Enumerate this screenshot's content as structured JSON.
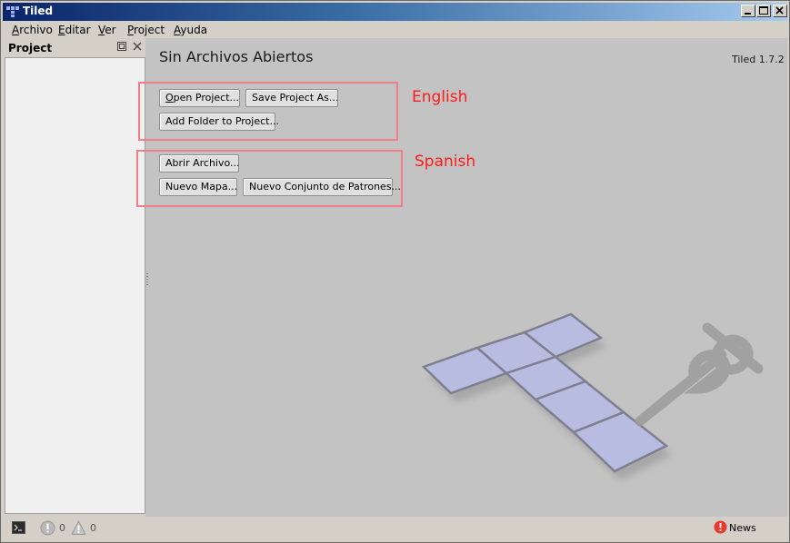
{
  "window": {
    "title": "Tiled",
    "controls": {
      "minimize_icon": "minimize-icon",
      "maximize_icon": "maximize-icon",
      "close_icon": "close-icon"
    }
  },
  "menubar": {
    "items": [
      {
        "label": "Archivo",
        "mnemonic": "A",
        "rest": "rchivo"
      },
      {
        "label": "Editar",
        "mnemonic": "E",
        "rest": "ditar"
      },
      {
        "label": "Ver",
        "mnemonic": "V",
        "rest": "er"
      },
      {
        "label": "Project",
        "mnemonic": "P",
        "rest": "roject"
      },
      {
        "label": "Ayuda",
        "mnemonic": "A",
        "rest": "yuda"
      }
    ]
  },
  "project_dock": {
    "title": "Project"
  },
  "welcome": {
    "heading": "Sin Archivos Abiertos",
    "version": "Tiled 1.7.2",
    "english_buttons": [
      {
        "label": "Open Project...",
        "mnemonic": "O",
        "rest": "pen Project..."
      },
      {
        "label": "Save Project As..."
      },
      {
        "label": "Add Folder to Project..."
      }
    ],
    "spanish_buttons": [
      {
        "label": "Abrir Archivo..."
      },
      {
        "label": "Nuevo Mapa..."
      },
      {
        "label": "Nuevo Conjunto de Patrones..."
      }
    ],
    "annotations": {
      "english": "English",
      "spanish": "Spanish"
    }
  },
  "statusbar": {
    "errors": "0",
    "warnings": "0",
    "news": "News"
  },
  "colors": {
    "titlebar_start": "#0a246a",
    "titlebar_end": "#a6caf0",
    "annotation_box": "#ef7f86",
    "annotation_text": "#ff1a1a",
    "news_badge": "#e23b30"
  }
}
